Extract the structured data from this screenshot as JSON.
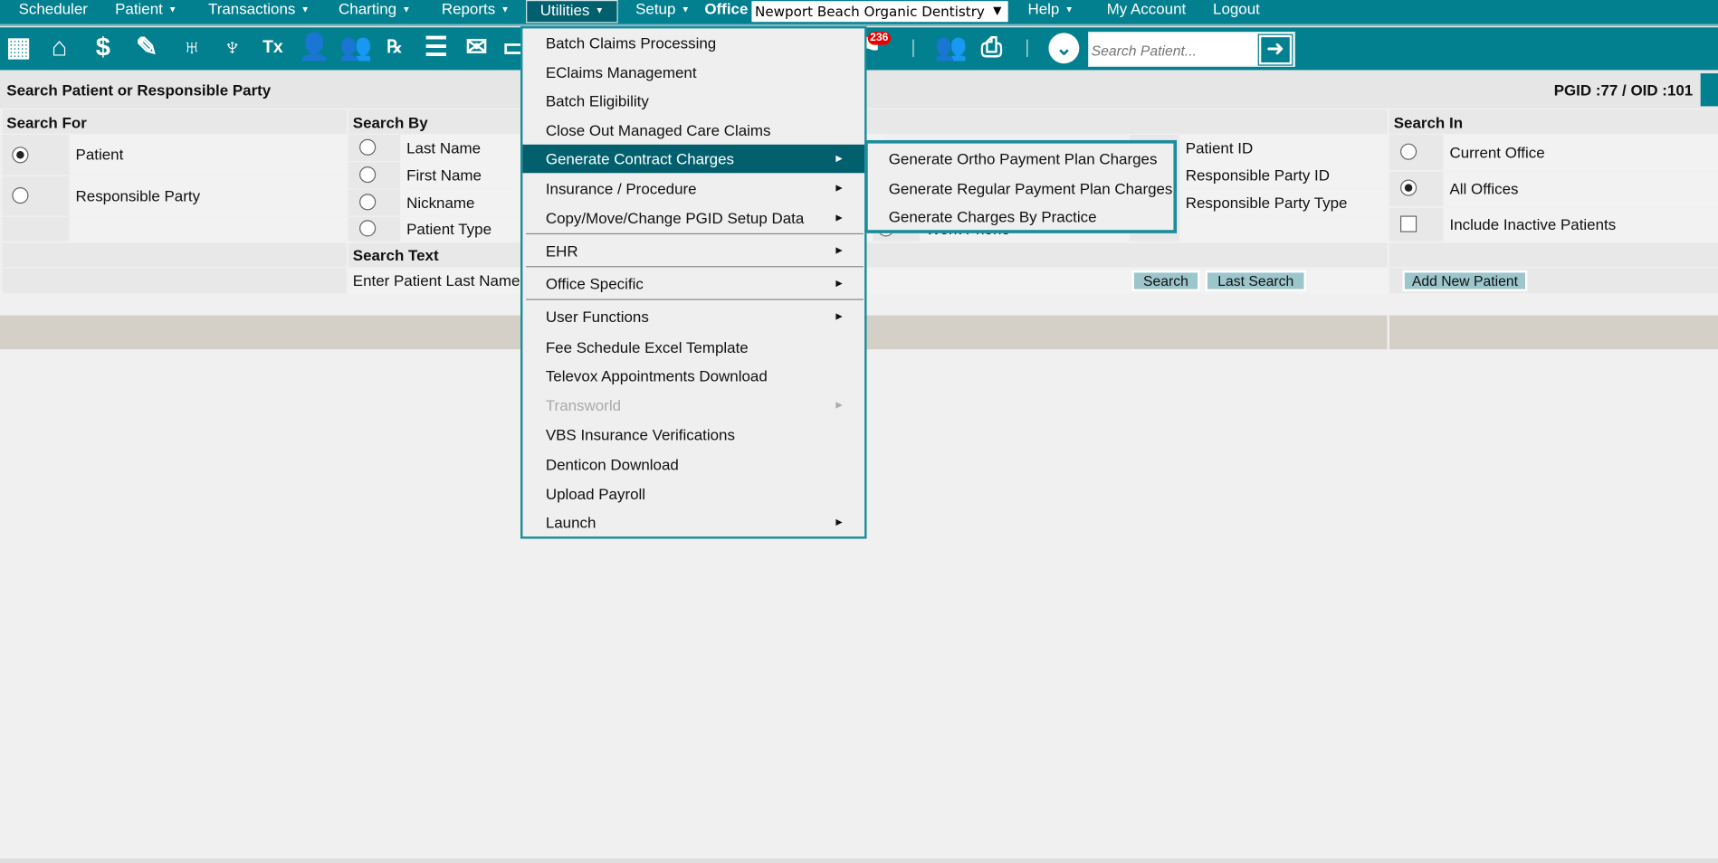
{
  "nav": {
    "items": [
      {
        "label": "Scheduler",
        "dropdown": false
      },
      {
        "label": "Patient",
        "dropdown": true
      },
      {
        "label": "Transactions",
        "dropdown": true
      },
      {
        "label": "Charting",
        "dropdown": true
      },
      {
        "label": "Reports",
        "dropdown": true
      },
      {
        "label": "Utilities",
        "dropdown": true,
        "active": true
      },
      {
        "label": "Setup",
        "dropdown": true
      }
    ],
    "office_label": "Office",
    "office_value": "Newport Beach Organic Dentistry",
    "right_items": [
      {
        "label": "Help",
        "dropdown": true
      },
      {
        "label": "My Account"
      },
      {
        "label": "Logout"
      }
    ]
  },
  "toolbar": {
    "icons": [
      "calendar-icon",
      "home-icon",
      "billing-icon",
      "notes-edit-icon",
      "tooth-icon",
      "crown-tooth-icon",
      "treatment-plan-icon",
      "add-patient-icon",
      "add-family-icon",
      "prescription-icon",
      "notepad-icon",
      "mail-icon",
      "chat-icon",
      "alerts-icon",
      "users-icon",
      "print-scan-icon",
      "expand-icon"
    ],
    "badge": "236",
    "search_placeholder": "Search Patient..."
  },
  "title": {
    "text": "Search Patient or Responsible Party",
    "ids": "PGID :77  /  OID :101"
  },
  "search_for": {
    "header": "Search For",
    "options": [
      {
        "label": "Patient",
        "selected": true
      },
      {
        "label": "Responsible Party",
        "selected": false
      }
    ]
  },
  "search_by": {
    "header": "Search By",
    "options": [
      {
        "label": "Last Name"
      },
      {
        "label": "First Name"
      },
      {
        "label": "Nickname"
      },
      {
        "label": "Patient Type"
      },
      {
        "label": "Work Phone"
      },
      {
        "label": "Patient ID"
      },
      {
        "label": "Responsible Party ID"
      },
      {
        "label": "Responsible Party Type"
      }
    ],
    "text_header": "Search Text",
    "input_label": "Enter Patient Last Name:",
    "search_btn": "Search",
    "last_search_btn": "Last Search"
  },
  "search_in": {
    "header": "Search In",
    "options": [
      {
        "label": "Current Office",
        "selected": false
      },
      {
        "label": "All Offices",
        "selected": true
      }
    ],
    "inactive_label": "Include Inactive Patients",
    "inactive_checked": false,
    "add_btn": "Add New Patient"
  },
  "utilities_menu": [
    {
      "label": "Batch Claims Processing"
    },
    {
      "label": "EClaims Management"
    },
    {
      "label": "Batch Eligibility"
    },
    {
      "label": "Close Out Managed Care Claims"
    },
    {
      "label": "Generate Contract Charges",
      "sub": true,
      "active": true
    },
    {
      "label": "Insurance / Procedure",
      "sub": true
    },
    {
      "label": "Copy/Move/Change PGID Setup Data",
      "sub": true
    },
    {
      "label": "EHR",
      "sub": true
    },
    {
      "label": "Office Specific",
      "sub": true
    },
    {
      "label": "User Functions",
      "sub": true
    },
    {
      "label": "Fee Schedule Excel Template"
    },
    {
      "label": "Televox Appointments Download"
    },
    {
      "label": "Transworld",
      "sub": true,
      "disabled": true
    },
    {
      "label": "VBS Insurance Verifications"
    },
    {
      "label": "Denticon Download"
    },
    {
      "label": "Upload Payroll"
    },
    {
      "label": "Launch",
      "sub": true
    }
  ],
  "submenu": [
    {
      "label": "Generate Ortho Payment Plan Charges"
    },
    {
      "label": "Generate Regular Payment Plan Charges"
    },
    {
      "label": "Generate Charges By Practice"
    }
  ],
  "colors": {
    "brand": "#03808f",
    "menu_active": "#02606e",
    "button": "#9cc6cc"
  }
}
